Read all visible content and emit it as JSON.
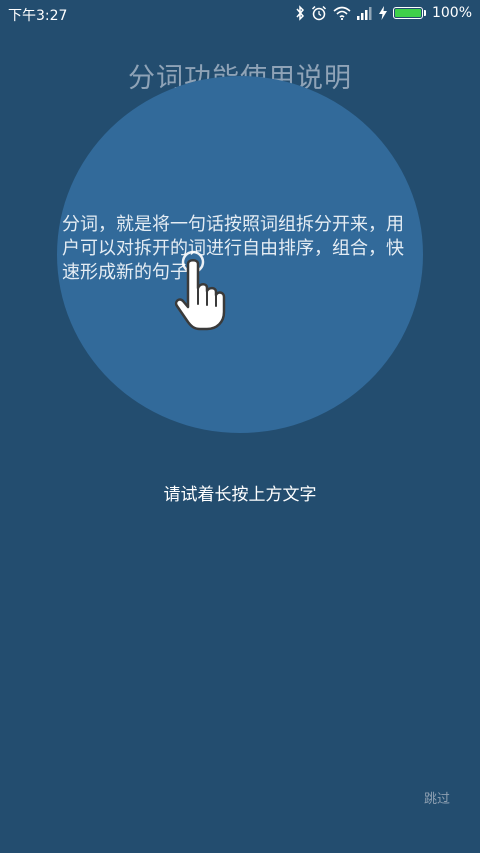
{
  "status_bar": {
    "time": "下午3:27",
    "icons": [
      "bluetooth-icon",
      "alarm-icon",
      "wifi-icon",
      "signal-icon",
      "charging-icon"
    ],
    "battery_percent": "100%",
    "battery_level": 1.0,
    "battery_color": "#3fd14a"
  },
  "page": {
    "title": "分词功能使用说明",
    "description": "分词，就是将一句话按照词组拆分开来，用户可以对拆开的词进行自由排序，组合，快速形成新的句子。",
    "hint": "请试着长按上方文字",
    "skip_label": "跳过",
    "gesture_icon": "hand-pointer-icon"
  },
  "colors": {
    "background": "#234d6f",
    "circle": "#326a9a"
  }
}
